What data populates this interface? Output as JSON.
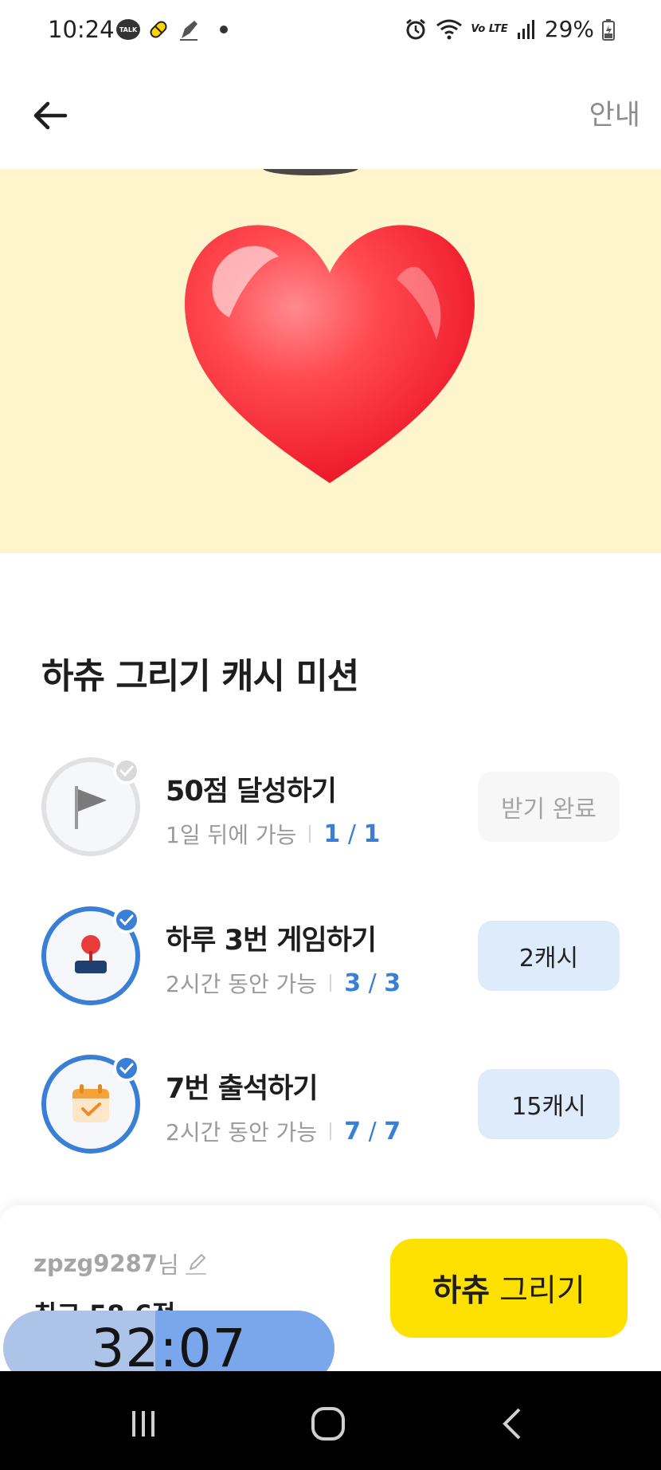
{
  "status_bar": {
    "time": "10:24",
    "talk_label": "TALK",
    "network": "Vo LTE",
    "battery": "29%"
  },
  "header": {
    "back_icon": "arrow-left-icon",
    "info_label": "안내"
  },
  "hero": {
    "image": "red-heart",
    "background_color": "#fff5cc"
  },
  "missions": {
    "title": "하츄 그리기 캐시 미션",
    "items": [
      {
        "icon": "flag-icon",
        "title": "50점 달성하기",
        "availability": "1일 뒤에 가능",
        "progress_done": "1",
        "progress_total": "1",
        "button_label": "받기 완료",
        "button_state": "disabled"
      },
      {
        "icon": "joystick-icon",
        "title": "하루 3번 게임하기",
        "availability": "2시간 동안 가능",
        "progress_done": "3",
        "progress_total": "3",
        "button_label": "2캐시",
        "button_state": "active"
      },
      {
        "icon": "calendar-check-icon",
        "title": "7번 출석하기",
        "availability": "2시간 동안 가능",
        "progress_done": "7",
        "progress_total": "7",
        "button_label": "15캐시",
        "button_state": "active"
      }
    ]
  },
  "bottom": {
    "user_id": "zpzg9287",
    "user_suffix": "님",
    "best_score": "최고 58.6점",
    "draw_button_bold": "하츄",
    "draw_button_rest": "그리기"
  },
  "timer": {
    "display": "32:07",
    "elapsed_fraction": 0.46
  },
  "colors": {
    "accent_blue": "#3a7fd6",
    "draw_button": "#ffe100"
  }
}
